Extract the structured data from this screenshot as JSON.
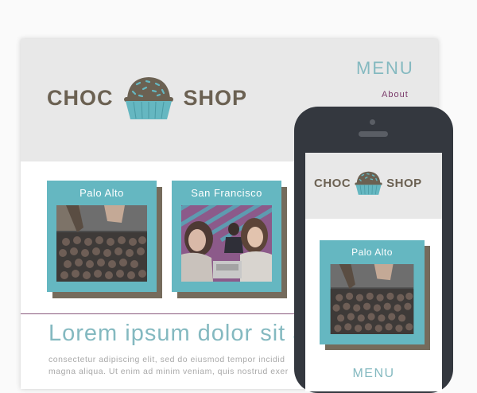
{
  "desktop": {
    "brand": {
      "left_word": "CHOC",
      "right_word": "SHOP",
      "logo_icon": "cupcake-icon"
    },
    "menu_label": "MENU",
    "nav": {
      "about": "About"
    },
    "cards": [
      {
        "city": "Palo Alto",
        "photo": "chocolate-truffles-tray-photo"
      },
      {
        "city": "San Francisco",
        "photo": "people-in-shop-photo"
      }
    ],
    "heading": "Lorem ipsum dolor sit a",
    "paragraph_lines": [
      "consectetur adipiscing elit, sed do eiusmod tempor incidid",
      "magna aliqua. Ut enim ad minim veniam, quis nostrud exer"
    ]
  },
  "mobile": {
    "brand": {
      "left_word": "CHOC",
      "right_word": "SHOP",
      "logo_icon": "cupcake-icon"
    },
    "cards": [
      {
        "city": "Palo Alto",
        "photo": "chocolate-truffles-tray-photo"
      }
    ],
    "menu_label": "MENU"
  },
  "colors": {
    "teal": "#65b7c1",
    "light_teal_text": "#84b9c0",
    "brown": "#6b6152",
    "plum": "#7a3a6a",
    "header_gray": "#e8e8e8",
    "phone_body": "#34383f"
  }
}
